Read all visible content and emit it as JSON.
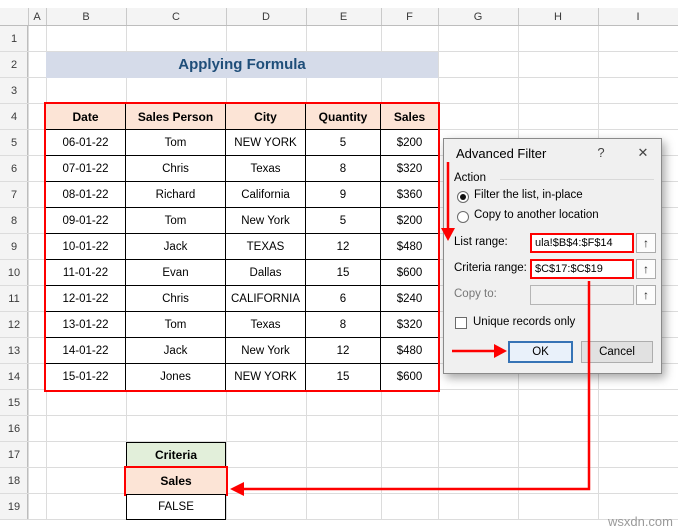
{
  "sheet": {
    "col_headers": [
      "A",
      "B",
      "C",
      "D",
      "E",
      "F",
      "G",
      "H",
      "I"
    ],
    "row_headers": [
      "1",
      "2",
      "3",
      "4",
      "5",
      "6",
      "7",
      "8",
      "9",
      "10",
      "11",
      "12",
      "13",
      "14",
      "15",
      "16",
      "17",
      "18",
      "19"
    ],
    "title": "Applying Formula"
  },
  "table": {
    "headers": [
      "Date",
      "Sales Person",
      "City",
      "Quantity",
      "Sales"
    ],
    "rows": [
      [
        "06-01-22",
        "Tom",
        "NEW YORK",
        "5",
        "$200"
      ],
      [
        "07-01-22",
        "Chris",
        "Texas",
        "8",
        "$320"
      ],
      [
        "08-01-22",
        "Richard",
        "California",
        "9",
        "$360"
      ],
      [
        "09-01-22",
        "Tom",
        "New York",
        "5",
        "$200"
      ],
      [
        "10-01-22",
        "Jack",
        "TEXAS",
        "12",
        "$480"
      ],
      [
        "11-01-22",
        "Evan",
        "Dallas",
        "15",
        "$600"
      ],
      [
        "12-01-22",
        "Chris",
        "CALIFORNIA",
        "6",
        "$240"
      ],
      [
        "13-01-22",
        "Tom",
        "Texas",
        "8",
        "$320"
      ],
      [
        "14-01-22",
        "Jack",
        "New York",
        "12",
        "$480"
      ],
      [
        "15-01-22",
        "Jones",
        "NEW YORK",
        "15",
        "$600"
      ]
    ]
  },
  "criteria": {
    "title": "Criteria",
    "header": "Sales",
    "value": "FALSE"
  },
  "dialog": {
    "title": "Advanced Filter",
    "help_icon": "?",
    "close_icon": "✕",
    "action_label": "Action",
    "filter_in_place": "Filter the list, in-place",
    "copy_to_location": "Copy to another location",
    "list_range_label": "List range:",
    "list_range_value": "ula!$B$4:$F$14",
    "criteria_range_label": "Criteria range:",
    "criteria_range_value": "$C$17:$C$19",
    "copy_to_label": "Copy to:",
    "copy_to_value": "",
    "unique_records": "Unique records only",
    "picker_icon": "↑",
    "ok_label": "OK",
    "cancel_label": "Cancel"
  },
  "watermark": "wsxdn.com",
  "colors": {
    "annotation_red": "#FE0000",
    "table_header_fill": "#FCE4D6",
    "title_fill": "#D5DBE9",
    "title_text": "#1F4E79",
    "criteria_fill": "#E2EFDA",
    "ok_border_blue": "#3673B5"
  }
}
